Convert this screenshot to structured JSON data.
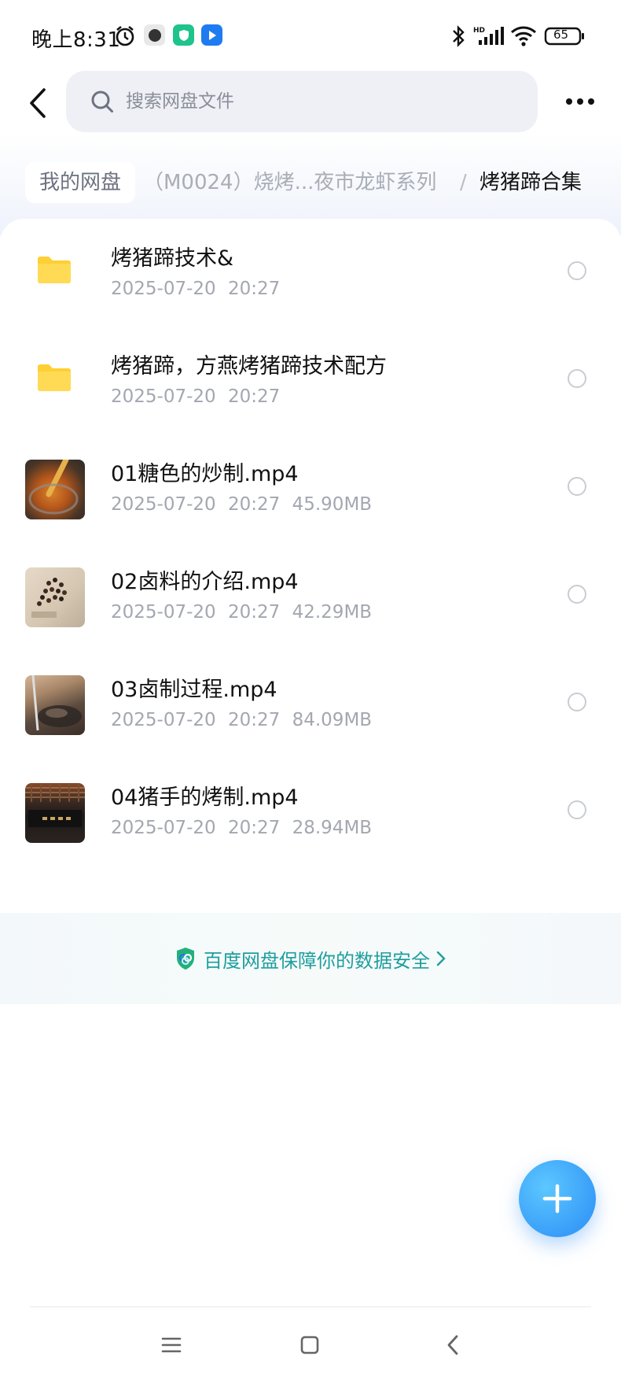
{
  "status_bar": {
    "time": "晚上8:31",
    "battery": "65",
    "icons": [
      "alarm-icon",
      "app-dot-icon",
      "shield-app-icon",
      "blue-app-icon",
      "bluetooth-icon",
      "signal-hd-icon",
      "wifi-icon",
      "battery-icon"
    ]
  },
  "header": {
    "search_placeholder": "搜索网盘文件"
  },
  "breadcrumb": {
    "root": "我的网盘",
    "middle": "（M0024）烧烤...夜市龙虾系列",
    "separator": "/",
    "current": "烤猪蹄合集"
  },
  "files": [
    {
      "name": "烤猪蹄技术&",
      "date": "2025-07-20",
      "time": "20:27",
      "size": "",
      "type": "folder"
    },
    {
      "name": "烤猪蹄，方燕烤猪蹄技术配方",
      "date": "2025-07-20",
      "time": "20:27",
      "size": "",
      "type": "folder"
    },
    {
      "name": "01糖色的炒制.mp4",
      "date": "2025-07-20",
      "time": "20:27",
      "size": "45.90MB",
      "type": "video"
    },
    {
      "name": "02卤料的介绍.mp4",
      "date": "2025-07-20",
      "time": "20:27",
      "size": "42.29MB",
      "type": "video"
    },
    {
      "name": "03卤制过程.mp4",
      "date": "2025-07-20",
      "time": "20:27",
      "size": "84.09MB",
      "type": "video"
    },
    {
      "name": "04猪手的烤制.mp4",
      "date": "2025-07-20",
      "time": "20:27",
      "size": "28.94MB",
      "type": "video"
    }
  ],
  "security_banner": {
    "text": "百度网盘保障你的数据安全"
  },
  "colors": {
    "accent": "#2a8cf6",
    "folder": "#ffd23f",
    "security_text": "#1f9e9e"
  }
}
